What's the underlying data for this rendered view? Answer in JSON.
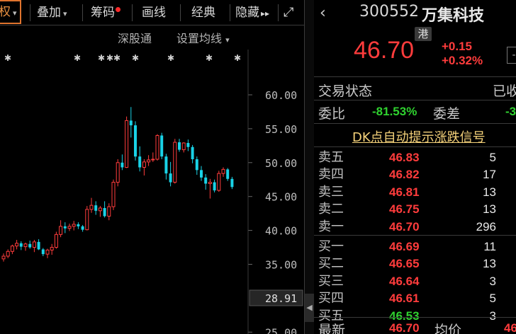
{
  "toolbar": {
    "items": [
      {
        "label": "权",
        "caret": "▾"
      },
      {
        "label": "叠加",
        "caret": "▾"
      },
      {
        "label": "筹码"
      },
      {
        "label": "画线"
      },
      {
        "label": "经典"
      },
      {
        "label": "隐藏",
        "arrows": "▸▸"
      }
    ],
    "expand_icon": "⤢"
  },
  "subtoolbar": {
    "market": "深股通",
    "ma_settings": "设置均线",
    "ma_caret": "▾"
  },
  "chart_data": {
    "type": "candlestick",
    "title": "",
    "ylim": [
      25,
      62
    ],
    "yticks": [
      "60.00",
      "55.00",
      "50.00",
      "45.00",
      "40.00",
      "35.00",
      "25.00"
    ],
    "current_price_label": "28.91",
    "candles": [
      [
        35.8,
        36.6,
        35.4,
        36.2
      ],
      [
        36.2,
        37.2,
        35.9,
        36.9
      ],
      [
        36.9,
        37.9,
        36.5,
        37.7
      ],
      [
        37.7,
        38.6,
        37.2,
        38.1
      ],
      [
        38.1,
        38.4,
        37.1,
        37.6
      ],
      [
        37.6,
        38.2,
        37.0,
        38.0
      ],
      [
        38.0,
        38.5,
        37.3,
        37.5
      ],
      [
        37.5,
        38.6,
        36.8,
        38.3
      ],
      [
        38.3,
        38.7,
        37.1,
        37.2
      ],
      [
        37.2,
        37.4,
        36.2,
        36.5
      ],
      [
        36.5,
        37.3,
        35.9,
        37.1
      ],
      [
        37.1,
        38.0,
        36.4,
        37.5
      ],
      [
        37.5,
        39.8,
        37.3,
        39.4
      ],
      [
        39.4,
        41.5,
        39.0,
        40.6
      ],
      [
        40.6,
        41.2,
        39.6,
        40.3
      ],
      [
        40.3,
        41.0,
        39.9,
        40.6
      ],
      [
        40.6,
        41.4,
        40.0,
        40.9
      ],
      [
        40.9,
        41.2,
        40.2,
        40.6
      ],
      [
        40.6,
        40.8,
        39.8,
        40.1
      ],
      [
        40.1,
        43.6,
        40.0,
        43.1
      ],
      [
        43.1,
        44.8,
        42.6,
        43.7
      ],
      [
        43.7,
        44.3,
        42.3,
        42.9
      ],
      [
        42.9,
        43.6,
        42.0,
        43.3
      ],
      [
        43.3,
        44.3,
        41.9,
        42.1
      ],
      [
        42.1,
        44.0,
        41.5,
        43.5
      ],
      [
        43.5,
        47.5,
        43.0,
        47.1
      ],
      [
        47.1,
        50.5,
        46.5,
        50.0
      ],
      [
        50.0,
        51.2,
        48.9,
        49.3
      ],
      [
        49.3,
        56.8,
        49.2,
        56.2
      ],
      [
        56.2,
        58.2,
        53.7,
        55.5
      ],
      [
        55.5,
        56.1,
        50.3,
        50.9
      ],
      [
        50.9,
        52.4,
        48.7,
        49.3
      ],
      [
        49.3,
        50.5,
        48.1,
        50.1
      ],
      [
        50.1,
        51.1,
        49.5,
        50.4
      ],
      [
        50.4,
        51.5,
        50.1,
        50.5
      ],
      [
        50.5,
        54.2,
        50.3,
        54.0
      ],
      [
        54.0,
        54.4,
        50.5,
        50.9
      ],
      [
        50.9,
        51.3,
        47.5,
        48.4
      ],
      [
        48.4,
        50.1,
        46.5,
        47.1
      ],
      [
        47.1,
        53.5,
        46.9,
        53.0
      ],
      [
        53.0,
        53.5,
        51.6,
        51.9
      ],
      [
        51.9,
        53.0,
        51.5,
        52.9
      ],
      [
        52.9,
        53.4,
        51.7,
        52.3
      ],
      [
        52.3,
        52.6,
        49.9,
        50.5
      ],
      [
        50.5,
        50.9,
        48.2,
        48.9
      ],
      [
        48.9,
        49.5,
        47.3,
        47.8
      ],
      [
        47.8,
        48.3,
        46.0,
        46.9
      ],
      [
        46.9,
        47.6,
        44.7,
        47.1
      ],
      [
        47.1,
        47.5,
        45.6,
        45.9
      ],
      [
        45.9,
        48.8,
        45.7,
        48.4
      ],
      [
        48.4,
        49.3,
        47.9,
        49.0
      ],
      [
        49.0,
        49.2,
        47.3,
        47.6
      ],
      [
        47.6,
        47.9,
        46.1,
        46.4
      ]
    ]
  },
  "stock": {
    "back": "‹",
    "code": "300552",
    "name": "万集科技",
    "tag": "港",
    "last_price": "46.70",
    "change_abs": "+0.15",
    "change_pct": "+0.32%",
    "side_button": "-"
  },
  "status": {
    "trade_status_label": "交易状态",
    "trade_status_value": "已收",
    "weibi_label": "委比",
    "weibi_value": "-81.53%",
    "weicha_label": "委差",
    "weicha_value": "-3"
  },
  "dk_signal": "DK点自动提示涨跌信号",
  "orderbook": {
    "asks": [
      {
        "label": "卖五",
        "price": "46.83",
        "vol": "5"
      },
      {
        "label": "卖四",
        "price": "46.82",
        "vol": "17"
      },
      {
        "label": "卖三",
        "price": "46.81",
        "vol": "13"
      },
      {
        "label": "卖二",
        "price": "46.75",
        "vol": "13"
      },
      {
        "label": "卖一",
        "price": "46.70",
        "vol": "296"
      }
    ],
    "bids": [
      {
        "label": "买一",
        "price": "46.69",
        "vol": "11"
      },
      {
        "label": "买二",
        "price": "46.65",
        "vol": "13"
      },
      {
        "label": "买三",
        "price": "46.64",
        "vol": "3"
      },
      {
        "label": "买四",
        "price": "46.61",
        "vol": "5"
      },
      {
        "label": "买五",
        "price": "46.53",
        "vol": "3"
      }
    ]
  },
  "summary": {
    "latest_label": "最新",
    "latest_value": "46.70",
    "avg_label": "均价",
    "avg_value": "46"
  },
  "colors": {
    "up": "#ff3c3c",
    "down": "#19d2e6",
    "green": "#2fd22f",
    "signal": "#f5d27a"
  }
}
